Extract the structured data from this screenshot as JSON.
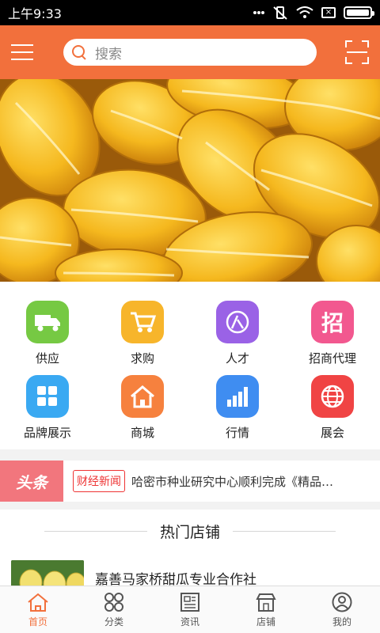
{
  "status_bar": {
    "time": "上午9:33",
    "battery_level": 1.0
  },
  "header": {
    "search_placeholder": "搜索"
  },
  "categories": [
    {
      "label": "供应",
      "icon": "truck-icon",
      "color": "#76c943"
    },
    {
      "label": "求购",
      "icon": "cart-icon",
      "color": "#f7b52b"
    },
    {
      "label": "人才",
      "icon": "person-icon",
      "color": "#9a62e6"
    },
    {
      "label": "招商代理",
      "icon": "zhao-icon",
      "color": "#f2588f",
      "glyph": "招"
    },
    {
      "label": "品牌展示",
      "icon": "grid-icon",
      "color": "#3aa9f2"
    },
    {
      "label": "商城",
      "icon": "house-icon",
      "color": "#f6813e"
    },
    {
      "label": "行情",
      "icon": "bar-chart-icon",
      "color": "#3f8df1"
    },
    {
      "label": "展会",
      "icon": "globe-icon",
      "color": "#f04444"
    }
  ],
  "news": {
    "tag": "头条",
    "badge": "财经新闻",
    "headline": "哈密市种业研究中心顺利完成《精品…"
  },
  "hot_stores": {
    "title": "热门店铺",
    "items": [
      {
        "name": "嘉善马家桥甜瓜专业合作社"
      }
    ]
  },
  "tabbar": [
    {
      "label": "首页",
      "icon": "home-icon",
      "active": true
    },
    {
      "label": "分类",
      "icon": "category-icon",
      "active": false
    },
    {
      "label": "资讯",
      "icon": "news-icon",
      "active": false
    },
    {
      "label": "店铺",
      "icon": "store-icon",
      "active": false
    },
    {
      "label": "我的",
      "icon": "profile-icon",
      "active": false
    }
  ],
  "colors": {
    "brand": "#f2703c",
    "news_tag": "#f2767d"
  }
}
